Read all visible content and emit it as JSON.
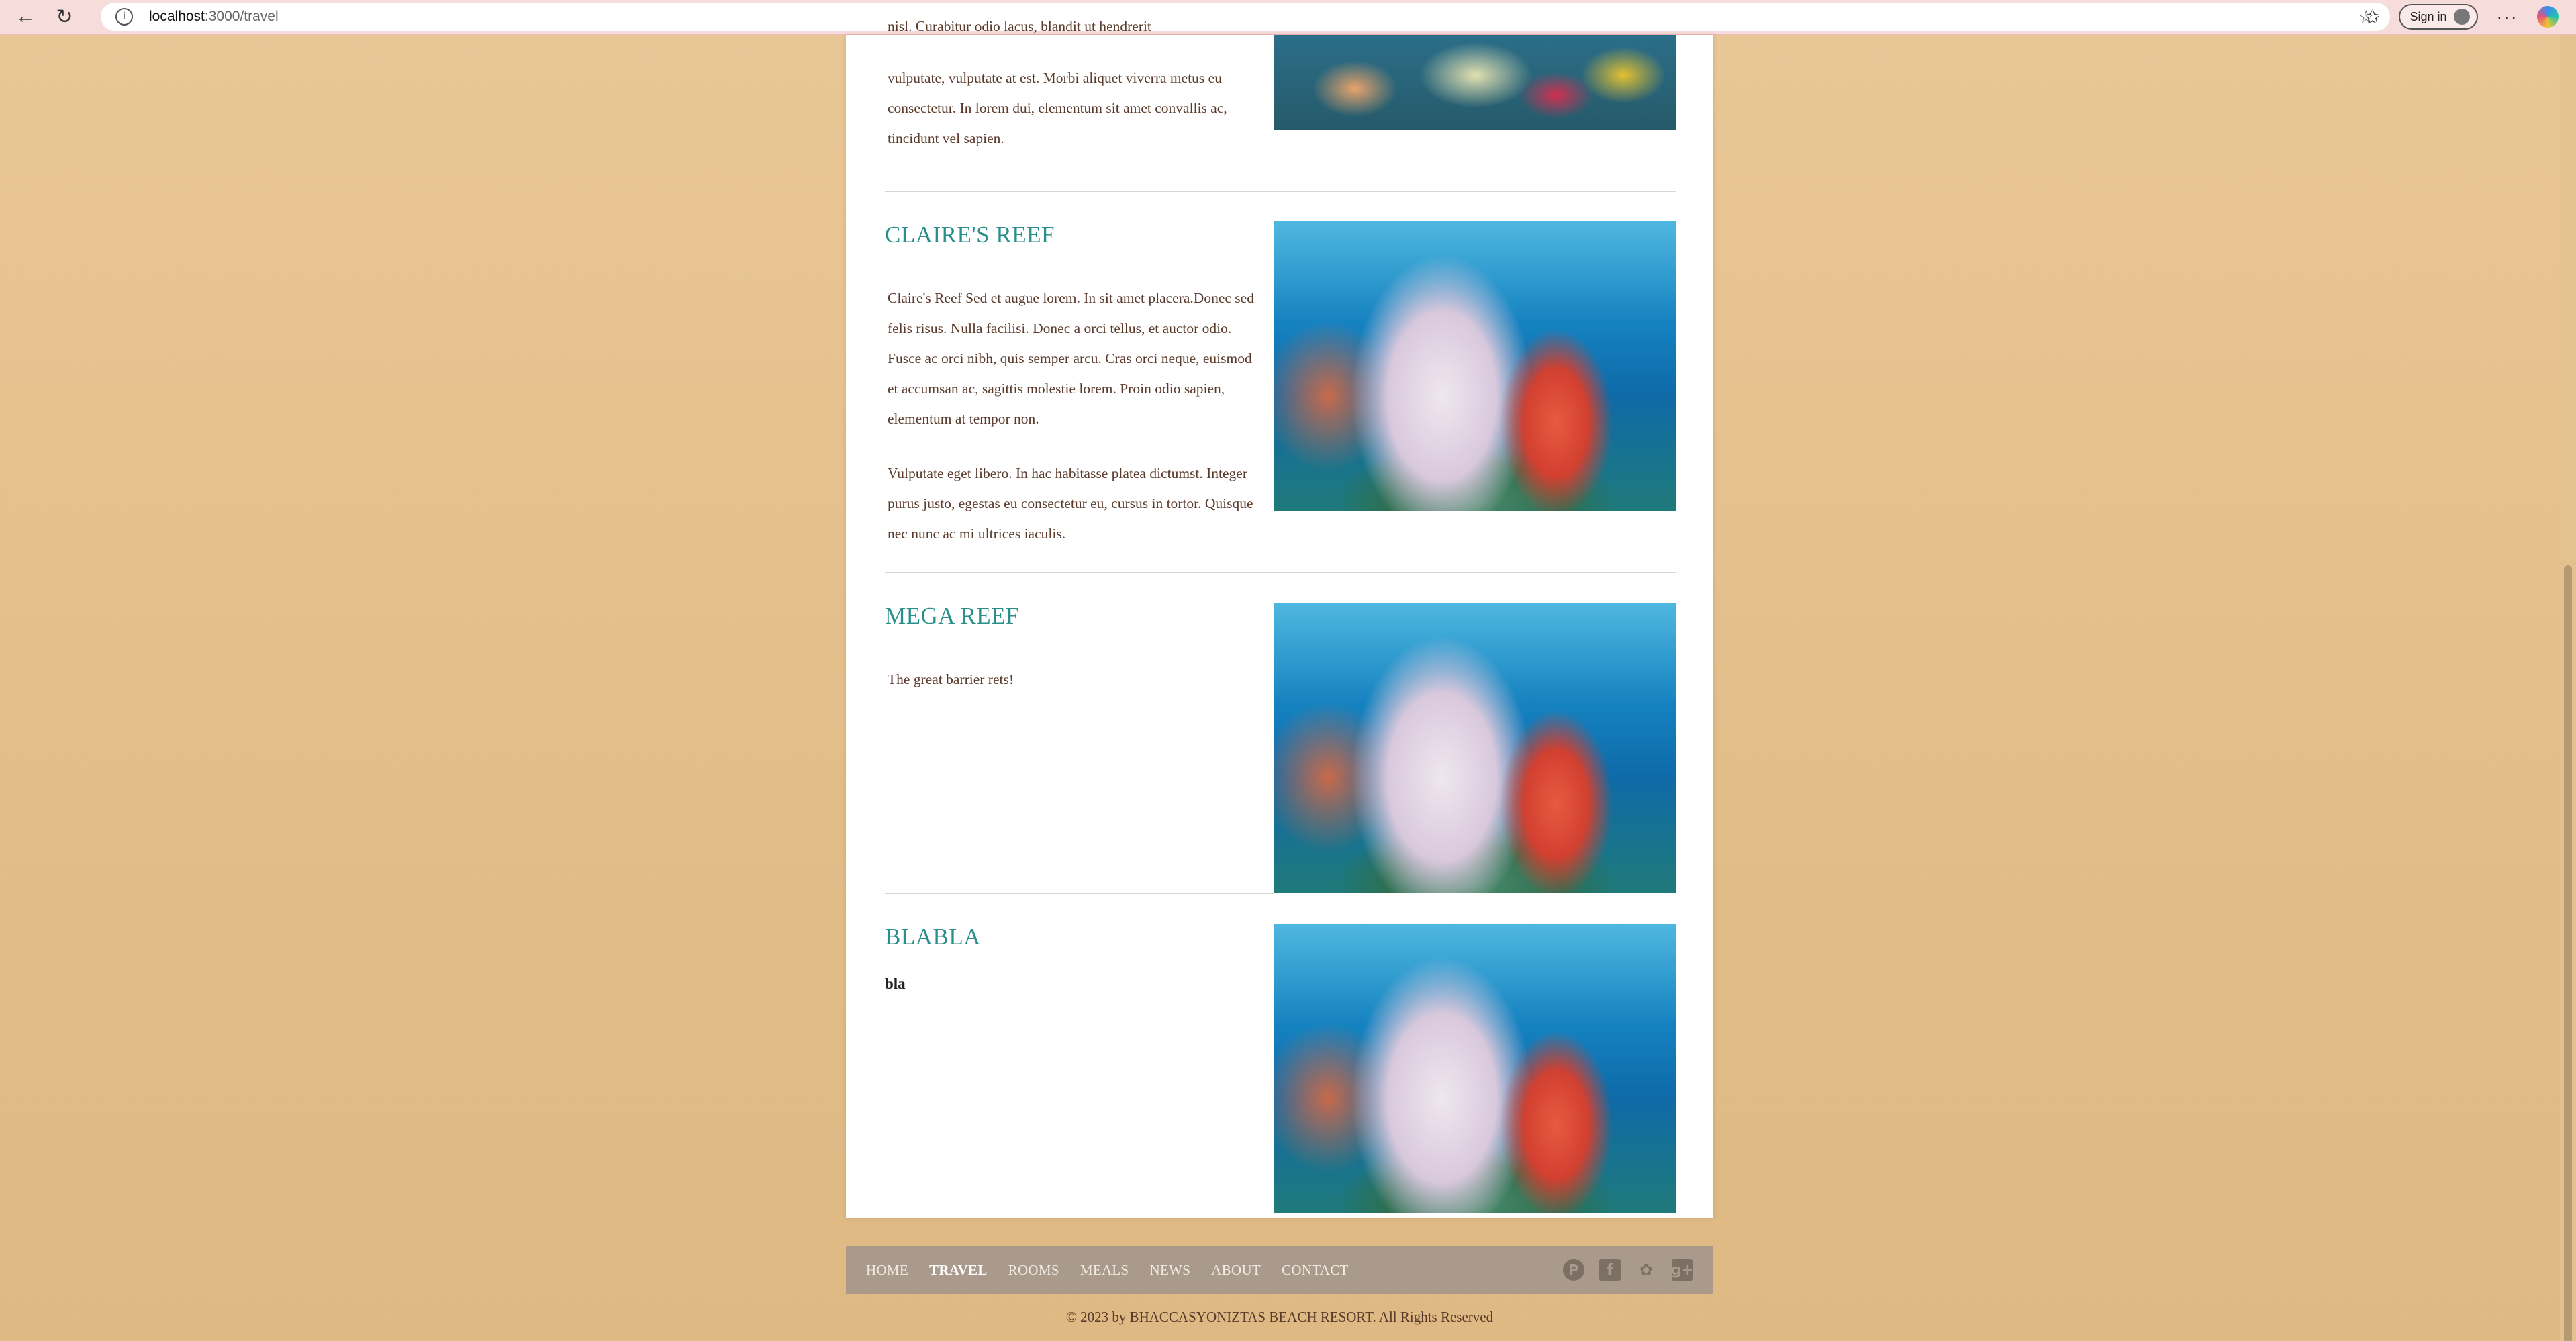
{
  "browser": {
    "url_host": "localhost",
    "url_path": ":3000/travel",
    "signin_label": "Sign in",
    "more_label": "···"
  },
  "sections": [
    {
      "clipped_line": "nisl. Curabitur odio lacus, blandit ut hendrerit",
      "paragraphs": [
        "vulputate, vulputate at est. Morbi aliquet viverra metus eu consectetur. In lorem dui, elementum sit amet convallis ac, tincidunt vel sapien."
      ]
    },
    {
      "title": "CLAIRE'S REEF",
      "paragraphs": [
        "Claire's Reef Sed et augue lorem. In sit amet placera.Donec sed felis risus. Nulla facilisi. Donec a orci tellus, et auctor odio. Fusce ac orci nibh, quis semper arcu. Cras orci neque, euismod et accumsan ac, sagittis molestie lorem. Proin odio sapien, elementum at tempor non.",
        "Vulputate eget libero. In hac habitasse platea dictumst. Integer purus justo, egestas eu consectetur eu, cursus in tortor. Quisque nec nunc ac mi ultrices iaculis."
      ]
    },
    {
      "title": "MEGA REEF",
      "paragraphs": [
        "The great barrier rets!"
      ]
    },
    {
      "title": "BLABLA",
      "bold_text": "bla"
    }
  ],
  "footer": {
    "nav": [
      "HOME",
      "TRAVEL",
      "ROOMS",
      "MEALS",
      "NEWS",
      "ABOUT",
      "CONTACT"
    ],
    "active": "TRAVEL",
    "social_icons": [
      "pinterest-icon",
      "facebook-icon",
      "twitter-icon",
      "google-plus-icon"
    ],
    "copyright": "© 2023 by BHACCASYONIZTAS BEACH RESORT. All Rights Reserved"
  },
  "colors": {
    "heading": "#2a8f8a",
    "body_text": "#5a3a2a",
    "footer_bg": "#a99a8c",
    "page_bg": "#e3bd88"
  }
}
